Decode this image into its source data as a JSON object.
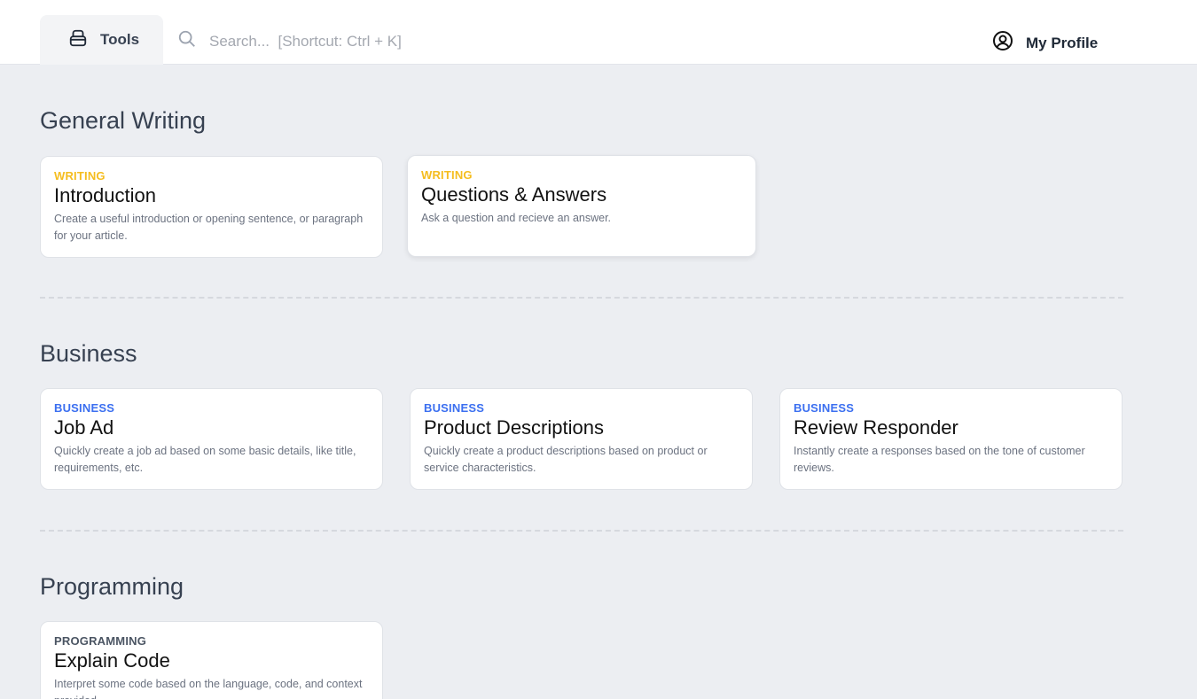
{
  "header": {
    "tools_label": "Tools",
    "search_placeholder": "Search...  [Shortcut: Ctrl + K]",
    "profile_label": "My Profile"
  },
  "colors": {
    "writing": "#f5bd1f",
    "business": "#3b6ff0",
    "programming": "#4b5563"
  },
  "sections": [
    {
      "title": "General Writing",
      "cards": [
        {
          "category": "WRITING",
          "title": "Introduction",
          "description": "Create a useful introduction or opening sentence, or paragraph for your article."
        },
        {
          "category": "WRITING",
          "title": "Questions & Answers",
          "description": "Ask a question and recieve an answer."
        }
      ]
    },
    {
      "title": "Business",
      "cards": [
        {
          "category": "BUSINESS",
          "title": "Job Ad",
          "description": "Quickly create a job ad based on some basic details, like title, requirements, etc."
        },
        {
          "category": "BUSINESS",
          "title": "Product Descriptions",
          "description": "Quickly create a product descriptions based on product or service characteristics."
        },
        {
          "category": "BUSINESS",
          "title": "Review Responder",
          "description": "Instantly create a responses based on the tone of customer reviews."
        }
      ]
    },
    {
      "title": "Programming",
      "cards": [
        {
          "category": "PROGRAMMING",
          "title": "Explain Code",
          "description": "Interpret some code based on the language, code, and context provided."
        }
      ]
    }
  ]
}
